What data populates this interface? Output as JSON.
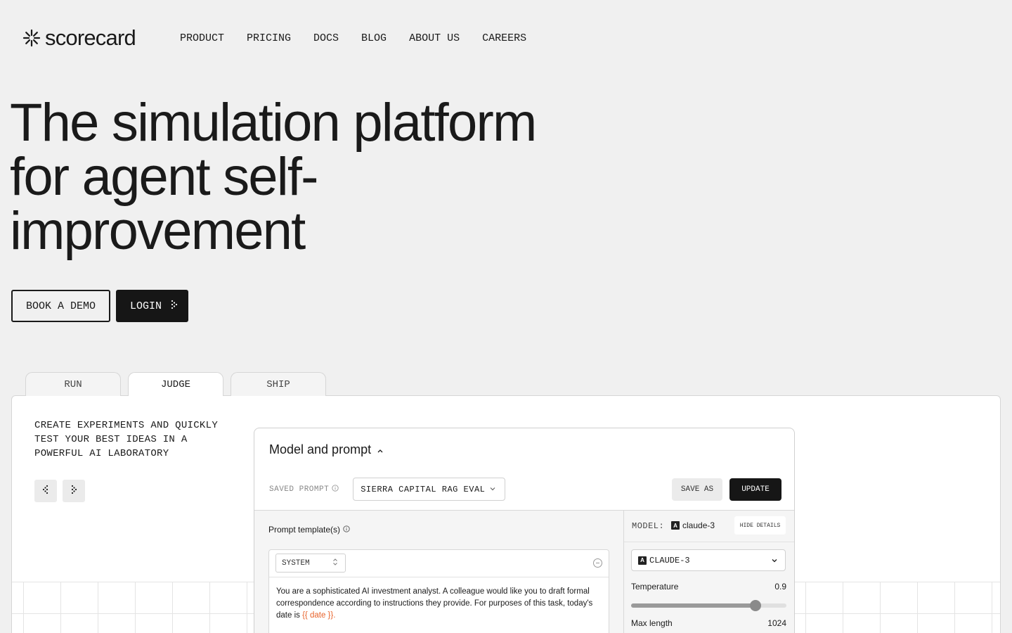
{
  "brand": {
    "name": "scorecard",
    "icon": "asterisk-logo-icon"
  },
  "nav": [
    {
      "label": "PRODUCT"
    },
    {
      "label": "PRICING"
    },
    {
      "label": "DOCS"
    },
    {
      "label": "BLOG"
    },
    {
      "label": "ABOUT US"
    },
    {
      "label": "CAREERS"
    }
  ],
  "hero": {
    "line1": "The simulation platform",
    "line2": "for agent self-",
    "line3": "improvement"
  },
  "cta": {
    "demo": "BOOK A DEMO",
    "login": "LOGIN",
    "login_icon": "dotted-arrow-right-icon"
  },
  "tabs": [
    {
      "label": "RUN",
      "active": false
    },
    {
      "label": "JUDGE",
      "active": true
    },
    {
      "label": "SHIP",
      "active": false
    }
  ],
  "panel": {
    "description": "CREATE EXPERIMENTS AND QUICKLY TEST YOUR BEST IDEAS IN A POWERFUL AI LABORATORY"
  },
  "card": {
    "title": "Model and prompt",
    "saved_prompt_label": "SAVED PROMPT",
    "saved_prompt_value": "SIERRA CAPITAL RAG EVAL",
    "save_as": "SAVE AS",
    "update": "UPDATE",
    "prompt_templates_label": "Prompt template(s)",
    "role": "SYSTEM",
    "message_text": "You are a sophisticated AI investment analyst. A colleague would like you to draft formal correspondence according to instructions they provide. For purposes of this task, today's date is ",
    "message_var": "{{ date }}",
    "message_end": ".",
    "model_label": "MODEL:",
    "model_name": "claude-3",
    "hide_details": "HIDE DETAILS",
    "model_select": "CLAUDE-3",
    "temperature_label": "Temperature",
    "temperature_value": "0.9",
    "temperature_level": 0.8,
    "max_length_label": "Max length",
    "max_length_value": "1024"
  },
  "colors": {
    "accent_dark": "#161616",
    "variable": "#e8632b",
    "background": "#f0f0f0"
  }
}
